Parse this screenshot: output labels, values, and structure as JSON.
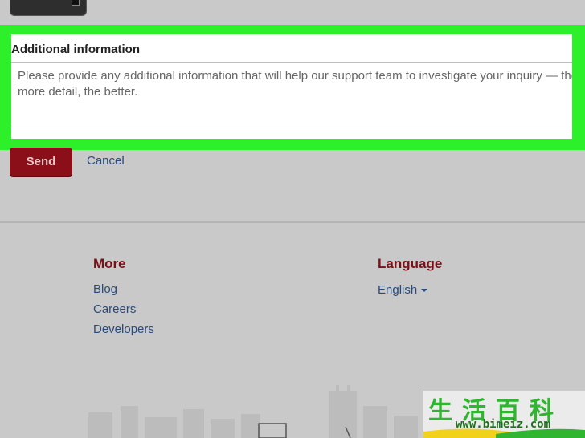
{
  "form": {
    "additional_info_label": "Additional information",
    "additional_info_placeholder": "Please provide any additional information that will help our support team to investigate your inquiry — the",
    "additional_info_placeholder_line2": "more detail, the better.",
    "send_label": "Send",
    "cancel_label": "Cancel"
  },
  "footer": {
    "more_heading": "More",
    "more_links": [
      "Blog",
      "Careers",
      "Developers"
    ],
    "language_heading": "Language",
    "language_value": "English"
  },
  "watermark": {
    "chinese": "生活百科",
    "url": "www.bimeiz.com"
  },
  "colors": {
    "highlight": "#2ef02a",
    "send_button": "#8a0f18",
    "link": "#2a4a7a",
    "heading": "#7a1018"
  }
}
